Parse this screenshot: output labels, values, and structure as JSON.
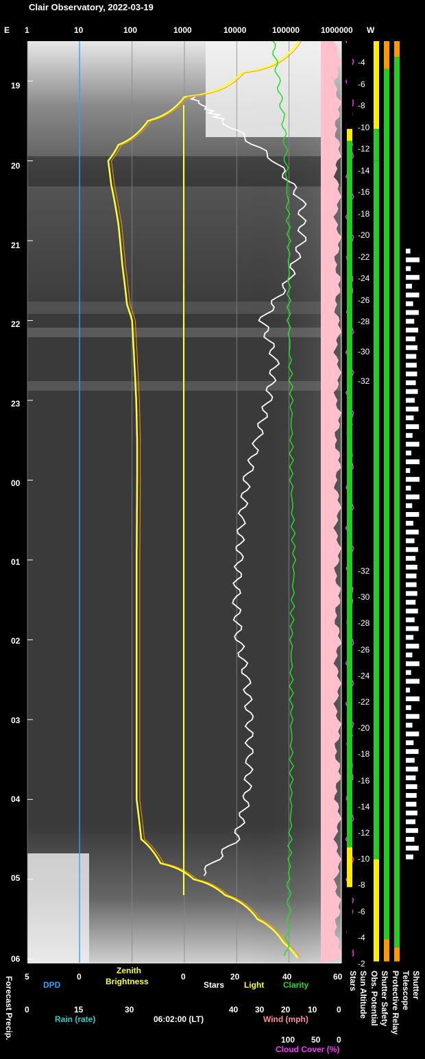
{
  "title": "Clair Observatory, 2022-03-19",
  "top_axis": {
    "left_label": "E",
    "right_label": "W",
    "ticks": [
      "1",
      "10",
      "100",
      "1000",
      "10000",
      "100000",
      "1000000"
    ]
  },
  "hour_ticks": [
    "19",
    "20",
    "21",
    "22",
    "23",
    "00",
    "01",
    "02",
    "03",
    "04",
    "05",
    "06"
  ],
  "sun_altitude_ticks_evening": [
    "-4",
    "-6",
    "-8",
    "-10",
    "-12",
    "-14",
    "-16",
    "-18",
    "-20",
    "-22",
    "-24",
    "-26",
    "-28",
    "-30",
    "-32"
  ],
  "sun_altitude_ticks_morning": [
    "-32",
    "-30",
    "-28",
    "-26",
    "-24",
    "-22",
    "-20",
    "-18",
    "-16",
    "-14",
    "-12",
    "-10",
    "-8",
    "-6",
    "-4",
    "-2"
  ],
  "bottom_axes": {
    "dpd_ticks": [
      "5",
      "0"
    ],
    "dpd_label": "DPD",
    "zenith_label_1": "Zenith",
    "zenith_label_2": "Brightness",
    "stars_ticks": [
      "0",
      "20",
      "40",
      "60"
    ],
    "stars_label": "Stars",
    "light_label": "Light",
    "clarity_label": "Clarity",
    "rain_ticks": [
      "0",
      "15",
      "30"
    ],
    "rain_label": "Rain (rate)",
    "time_label": "06:02:00 (LT)",
    "wind_ticks": [
      "40",
      "30",
      "20",
      "10",
      "0"
    ],
    "wind_label": "Wind (mph)",
    "cloud_ticks": [
      "100",
      "50",
      "0"
    ],
    "cloud_label": "Cloud Cover (%)"
  },
  "side_labels": {
    "forecast": "Forecast Precip.",
    "stars": "Stars",
    "sun_altitude": "Sun Altitude",
    "obs_potential": "Obs. Potential",
    "shutter_safety": "Shutter Safety",
    "protective_relay": "Protective Relay",
    "telescope": "Telescope",
    "shutter": "Shutter"
  },
  "colors": {
    "zenith": "#ffff33",
    "stars": "#ffffff",
    "light": "#ffff33",
    "clarity": "#22dd22",
    "dpd": "#22aaff",
    "rain": "#33cccc",
    "wind": "#ff88aa",
    "cloud": "#ff33ff",
    "cloud_fill": "#ffc0cb",
    "good": "#22cc22",
    "warn": "#ff9900",
    "caution": "#ffee00"
  },
  "chart_data": {
    "type": "line",
    "title": "Clair Observatory, 2022-03-19",
    "x_scale": "log",
    "xlim": [
      1,
      1000000
    ],
    "time_range": [
      "18:30",
      "06:02"
    ],
    "series": [
      {
        "name": "Zenith Brightness",
        "hours": [
          18.5,
          18.9,
          19.2,
          19.5,
          19.8,
          20.0,
          20.3,
          20.8,
          21.3,
          21.8,
          22.0,
          22.5,
          23.0,
          23.5,
          0.0,
          1.0,
          2.0,
          3.0,
          4.0,
          4.5,
          4.8,
          5.0,
          5.2,
          5.5,
          5.8,
          6.0
        ],
        "values": [
          150000,
          12000,
          1000,
          200,
          55,
          35,
          40,
          55,
          65,
          80,
          100,
          110,
          120,
          125,
          125,
          122,
          122,
          122,
          122,
          150,
          350,
          1500,
          6000,
          25000,
          80000,
          150000
        ]
      },
      {
        "name": "Stars",
        "hours": [
          19.2,
          19.5,
          20.0,
          20.5,
          21.0,
          21.5,
          22.0,
          22.5,
          23.0,
          23.5,
          0.0,
          0.5,
          1.0,
          1.5,
          2.0,
          2.5,
          3.0,
          3.5,
          4.0,
          4.5,
          5.0
        ],
        "values": [
          3,
          15,
          35,
          45,
          45,
          40,
          30,
          35,
          32,
          28,
          24,
          22,
          21,
          20,
          21,
          24,
          25,
          25,
          24,
          20,
          5
        ]
      },
      {
        "name": "Clarity",
        "hours": [
          18.5,
          19.0,
          19.5,
          20.0,
          21.0,
          22.0,
          23.0,
          0.0,
          1.0,
          2.0,
          3.0,
          4.0,
          5.0,
          5.5,
          6.0
        ],
        "values": [
          34,
          36,
          38,
          39,
          40,
          40,
          41,
          41,
          42,
          41,
          41,
          41,
          40,
          40,
          39
        ]
      },
      {
        "name": "Cloud Cover (%)",
        "hours": [
          18.5,
          20.0,
          22.0,
          0.0,
          2.0,
          4.0,
          6.0
        ],
        "values": [
          0,
          2,
          3,
          5,
          6,
          4,
          2
        ]
      }
    ],
    "sun_altitude_range": [
      -32,
      -2
    ]
  }
}
